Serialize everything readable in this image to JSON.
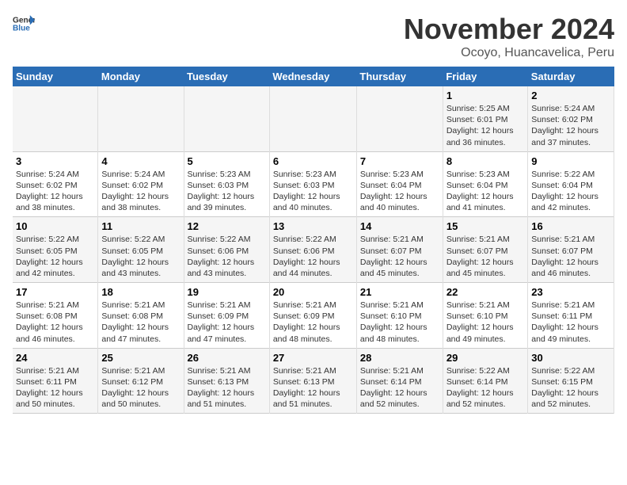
{
  "header": {
    "logo_general": "General",
    "logo_blue": "Blue",
    "month": "November 2024",
    "location": "Ocoyo, Huancavelica, Peru"
  },
  "weekdays": [
    "Sunday",
    "Monday",
    "Tuesday",
    "Wednesday",
    "Thursday",
    "Friday",
    "Saturday"
  ],
  "weeks": [
    [
      {
        "day": "",
        "info": ""
      },
      {
        "day": "",
        "info": ""
      },
      {
        "day": "",
        "info": ""
      },
      {
        "day": "",
        "info": ""
      },
      {
        "day": "",
        "info": ""
      },
      {
        "day": "1",
        "info": "Sunrise: 5:25 AM\nSunset: 6:01 PM\nDaylight: 12 hours\nand 36 minutes."
      },
      {
        "day": "2",
        "info": "Sunrise: 5:24 AM\nSunset: 6:02 PM\nDaylight: 12 hours\nand 37 minutes."
      }
    ],
    [
      {
        "day": "3",
        "info": "Sunrise: 5:24 AM\nSunset: 6:02 PM\nDaylight: 12 hours\nand 38 minutes."
      },
      {
        "day": "4",
        "info": "Sunrise: 5:24 AM\nSunset: 6:02 PM\nDaylight: 12 hours\nand 38 minutes."
      },
      {
        "day": "5",
        "info": "Sunrise: 5:23 AM\nSunset: 6:03 PM\nDaylight: 12 hours\nand 39 minutes."
      },
      {
        "day": "6",
        "info": "Sunrise: 5:23 AM\nSunset: 6:03 PM\nDaylight: 12 hours\nand 40 minutes."
      },
      {
        "day": "7",
        "info": "Sunrise: 5:23 AM\nSunset: 6:04 PM\nDaylight: 12 hours\nand 40 minutes."
      },
      {
        "day": "8",
        "info": "Sunrise: 5:23 AM\nSunset: 6:04 PM\nDaylight: 12 hours\nand 41 minutes."
      },
      {
        "day": "9",
        "info": "Sunrise: 5:22 AM\nSunset: 6:04 PM\nDaylight: 12 hours\nand 42 minutes."
      }
    ],
    [
      {
        "day": "10",
        "info": "Sunrise: 5:22 AM\nSunset: 6:05 PM\nDaylight: 12 hours\nand 42 minutes."
      },
      {
        "day": "11",
        "info": "Sunrise: 5:22 AM\nSunset: 6:05 PM\nDaylight: 12 hours\nand 43 minutes."
      },
      {
        "day": "12",
        "info": "Sunrise: 5:22 AM\nSunset: 6:06 PM\nDaylight: 12 hours\nand 43 minutes."
      },
      {
        "day": "13",
        "info": "Sunrise: 5:22 AM\nSunset: 6:06 PM\nDaylight: 12 hours\nand 44 minutes."
      },
      {
        "day": "14",
        "info": "Sunrise: 5:21 AM\nSunset: 6:07 PM\nDaylight: 12 hours\nand 45 minutes."
      },
      {
        "day": "15",
        "info": "Sunrise: 5:21 AM\nSunset: 6:07 PM\nDaylight: 12 hours\nand 45 minutes."
      },
      {
        "day": "16",
        "info": "Sunrise: 5:21 AM\nSunset: 6:07 PM\nDaylight: 12 hours\nand 46 minutes."
      }
    ],
    [
      {
        "day": "17",
        "info": "Sunrise: 5:21 AM\nSunset: 6:08 PM\nDaylight: 12 hours\nand 46 minutes."
      },
      {
        "day": "18",
        "info": "Sunrise: 5:21 AM\nSunset: 6:08 PM\nDaylight: 12 hours\nand 47 minutes."
      },
      {
        "day": "19",
        "info": "Sunrise: 5:21 AM\nSunset: 6:09 PM\nDaylight: 12 hours\nand 47 minutes."
      },
      {
        "day": "20",
        "info": "Sunrise: 5:21 AM\nSunset: 6:09 PM\nDaylight: 12 hours\nand 48 minutes."
      },
      {
        "day": "21",
        "info": "Sunrise: 5:21 AM\nSunset: 6:10 PM\nDaylight: 12 hours\nand 48 minutes."
      },
      {
        "day": "22",
        "info": "Sunrise: 5:21 AM\nSunset: 6:10 PM\nDaylight: 12 hours\nand 49 minutes."
      },
      {
        "day": "23",
        "info": "Sunrise: 5:21 AM\nSunset: 6:11 PM\nDaylight: 12 hours\nand 49 minutes."
      }
    ],
    [
      {
        "day": "24",
        "info": "Sunrise: 5:21 AM\nSunset: 6:11 PM\nDaylight: 12 hours\nand 50 minutes."
      },
      {
        "day": "25",
        "info": "Sunrise: 5:21 AM\nSunset: 6:12 PM\nDaylight: 12 hours\nand 50 minutes."
      },
      {
        "day": "26",
        "info": "Sunrise: 5:21 AM\nSunset: 6:13 PM\nDaylight: 12 hours\nand 51 minutes."
      },
      {
        "day": "27",
        "info": "Sunrise: 5:21 AM\nSunset: 6:13 PM\nDaylight: 12 hours\nand 51 minutes."
      },
      {
        "day": "28",
        "info": "Sunrise: 5:21 AM\nSunset: 6:14 PM\nDaylight: 12 hours\nand 52 minutes."
      },
      {
        "day": "29",
        "info": "Sunrise: 5:22 AM\nSunset: 6:14 PM\nDaylight: 12 hours\nand 52 minutes."
      },
      {
        "day": "30",
        "info": "Sunrise: 5:22 AM\nSunset: 6:15 PM\nDaylight: 12 hours\nand 52 minutes."
      }
    ]
  ]
}
